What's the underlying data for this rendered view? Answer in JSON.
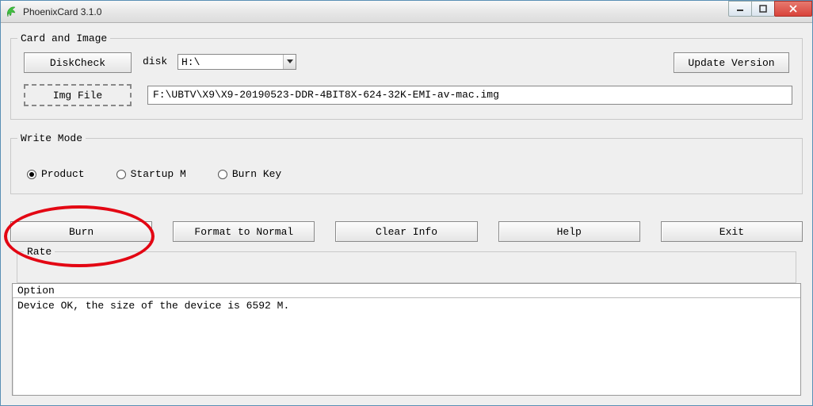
{
  "window": {
    "title": "PhoenixCard 3.1.0"
  },
  "card_and_image": {
    "legend": "Card and Image",
    "diskcheck_label": "DiskCheck",
    "disk_label": "disk",
    "disk_value": "H:\\",
    "update_label": "Update Version",
    "imgfile_label": "Img File",
    "img_path": "F:\\UBTV\\X9\\X9-20190523-DDR-4BIT8X-624-32K-EMI-av-mac.img"
  },
  "write_mode": {
    "legend": "Write Mode",
    "options": {
      "product": "Product",
      "startup": "Startup M",
      "burnkey": "Burn Key"
    },
    "selected": "product"
  },
  "buttons": {
    "burn": "Burn",
    "format": "Format to Normal",
    "clear": "Clear Info",
    "help": "Help",
    "exit": "Exit"
  },
  "rate": {
    "legend": "Rate"
  },
  "option": {
    "header": "Option",
    "log": "Device OK, the size of the device is 6592 M."
  }
}
